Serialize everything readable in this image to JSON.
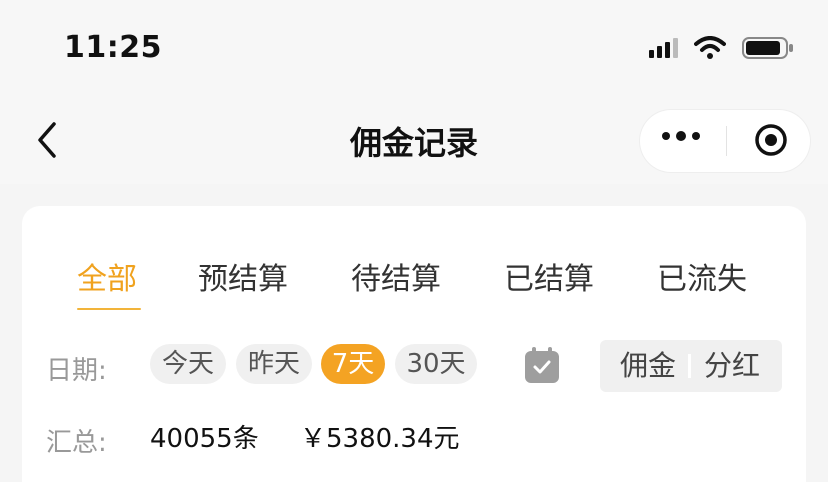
{
  "status_bar": {
    "time": "11:25"
  },
  "navbar": {
    "title": "佣金记录"
  },
  "tabs": [
    {
      "label": "全部",
      "active": true
    },
    {
      "label": "预结算",
      "active": false
    },
    {
      "label": "待结算",
      "active": false
    },
    {
      "label": "已结算",
      "active": false
    },
    {
      "label": "已流失",
      "active": false
    }
  ],
  "date_filter": {
    "label": "日期:",
    "options": [
      "今天",
      "昨天",
      "7天",
      "30天"
    ],
    "selected": "7天"
  },
  "type_toggle": {
    "options": [
      "佣金",
      "分红"
    ]
  },
  "summary": {
    "label": "汇总:",
    "count": "40055条",
    "amount": "￥5380.34元"
  },
  "colors": {
    "accent": "#f4a323",
    "tab_active": "#f0a21e"
  }
}
